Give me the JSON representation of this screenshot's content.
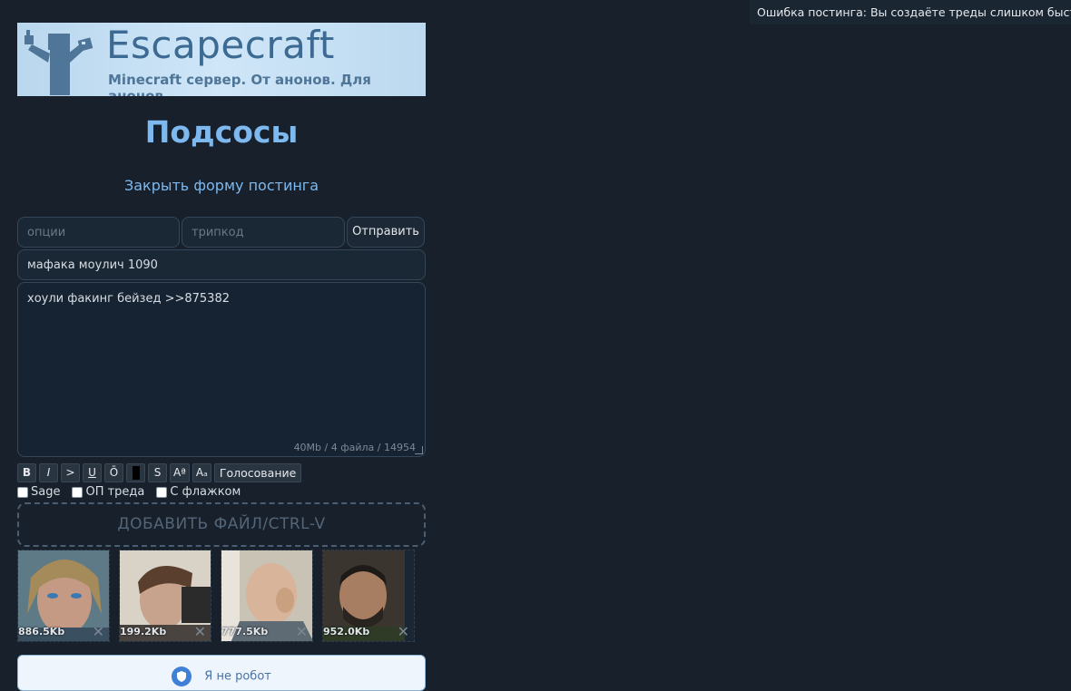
{
  "error": {
    "text": "Ошибка постинга: Вы создаёте треды слишком быстро."
  },
  "banner": {
    "title": "Escapecraft",
    "subtitle": "Minecraft сервер. От анонов. Для анонов."
  },
  "board": {
    "title": "Подсосы",
    "close_form_label": "Закрыть форму постинга"
  },
  "form": {
    "options_placeholder": "опции",
    "tripcode_placeholder": "трипкод",
    "send_label": "Отправить",
    "subject_value": "мафака моулич 1090",
    "comment_value": "хоули факинг бейзед >>875382",
    "limits": "40Mb / 4 файла / 14954"
  },
  "toolbar": {
    "bold": "B",
    "italic": "I",
    "quote": ">",
    "underline": "U",
    "overline": "Ō",
    "strike": "S",
    "sup": "Aª",
    "sub": "Aₐ",
    "poll": "Голосование"
  },
  "checkboxes": {
    "sage": "Sage",
    "op": "ОП треда",
    "flag": "С флажком"
  },
  "dropzone": {
    "label": "ДОБАВИТЬ ФАЙЛ/CTRL-V"
  },
  "files": [
    {
      "size": "886.5Kb",
      "icon": "close-icon"
    },
    {
      "size": "199.2Kb",
      "icon": "close-icon"
    },
    {
      "size": "777.5Kb",
      "icon": "close-icon"
    },
    {
      "size": "952.0Kb",
      "icon": "close-icon"
    }
  ],
  "captcha": {
    "label": "Я не робот"
  },
  "colors": {
    "background": "#17202b",
    "accent": "#7db8ee"
  }
}
